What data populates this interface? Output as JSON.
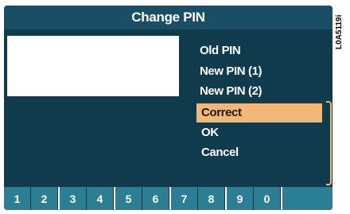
{
  "title": "Change PIN",
  "fields": [
    {
      "label": "Old PIN",
      "value": ""
    },
    {
      "label": "New PIN (1)",
      "value": ""
    },
    {
      "label": "New PIN (2)",
      "value": ""
    }
  ],
  "menu": [
    {
      "label": "Correct",
      "selected": true
    },
    {
      "label": "OK",
      "selected": false
    },
    {
      "label": "Cancel",
      "selected": false
    }
  ],
  "keypad": [
    "1",
    "2",
    "3",
    "4",
    "5",
    "6",
    "7",
    "8",
    "9",
    "0"
  ],
  "side_code": "L0A5119i",
  "colors": {
    "screen_bg": "#0f3b4d",
    "title_bg": "#184e66",
    "key_bg": "#2b7f95",
    "accent": "#f1b877"
  }
}
